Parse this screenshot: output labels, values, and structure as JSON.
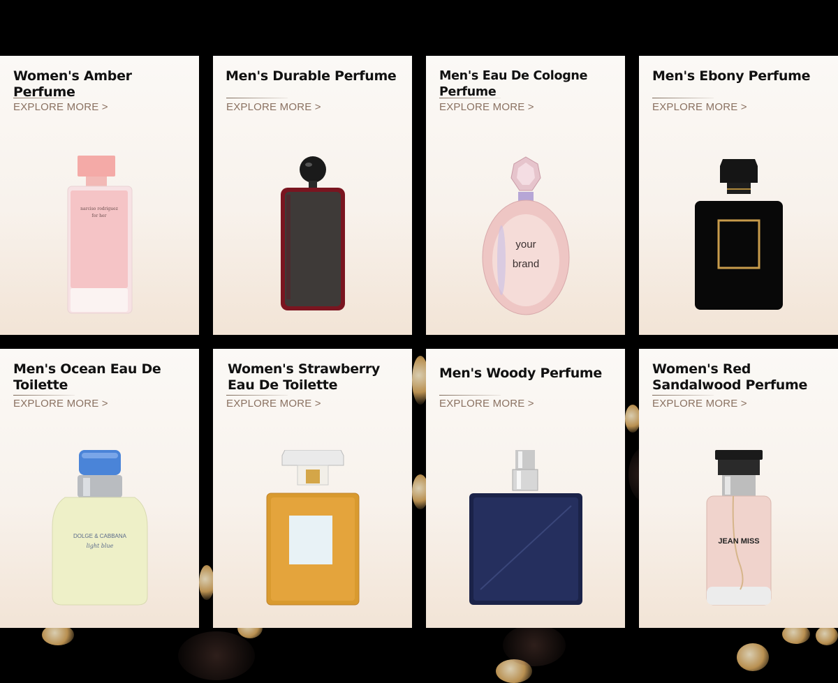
{
  "products": [
    {
      "title": "Women's Amber Perfume",
      "link": "EXPLORE MORE >",
      "bottle_icon": "pink-square-bottle-icon",
      "bottle_label_1": "narciso rodriguez",
      "bottle_label_2": "for her",
      "accent": "#f6c3c0"
    },
    {
      "title": "Men's Durable Perfume",
      "link": "EXPLORE MORE >",
      "bottle_icon": "burgundy-slim-bottle-icon",
      "accent": "#7a1520"
    },
    {
      "title": "Men's Eau De Cologne Perfume",
      "link": "EXPLORE MORE >",
      "bottle_icon": "round-crystal-bottle-icon",
      "bottle_label_1": "your",
      "bottle_label_2": "brand",
      "accent": "#e3b2b6"
    },
    {
      "title": "Men's Ebony Perfume",
      "link": "EXPLORE MORE >",
      "bottle_icon": "black-square-bottle-icon",
      "accent": "#0b0b0b"
    },
    {
      "title": "Men's Ocean Eau De Toilette",
      "link": "EXPLORE MORE >",
      "bottle_icon": "light-blue-bottle-icon",
      "bottle_label_1": "DOLGE & CABBANA",
      "bottle_label_2": "light blue",
      "accent": "#eef0c8"
    },
    {
      "title": "Women's Strawberry Eau De Toilette",
      "link": "EXPLORE MORE >",
      "bottle_icon": "amber-glass-bottle-icon",
      "accent": "#d99a2f"
    },
    {
      "title": "Men's Woody Perfume",
      "link": "EXPLORE MORE >",
      "bottle_icon": "navy-square-bottle-icon",
      "accent": "#1b2349"
    },
    {
      "title": "Women's Red Sandalwood Perfume",
      "link": "EXPLORE MORE >",
      "bottle_icon": "blush-cylinder-bottle-icon",
      "bottle_label_1": "JEAN MISS",
      "accent": "#f0d3cc"
    }
  ]
}
